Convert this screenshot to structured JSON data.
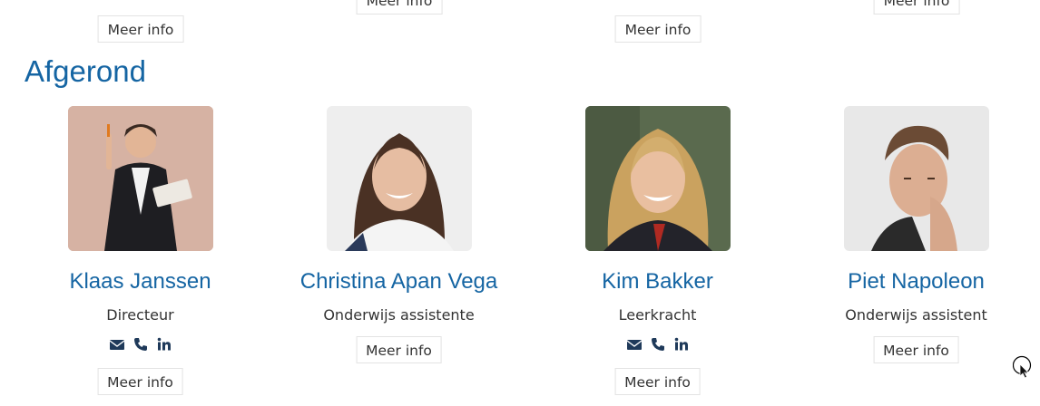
{
  "top_row": {
    "buttons": [
      "Meer info",
      "Meer info",
      "Meer info",
      "Meer info"
    ]
  },
  "section": {
    "title": "Afgerond"
  },
  "people": [
    {
      "name": "Klaas Janssen",
      "role": "Directeur",
      "button": "Meer info",
      "has_contacts": true
    },
    {
      "name": "Christina Apan Vega",
      "role": "Onderwijs assistente",
      "button": "Meer info",
      "has_contacts": false
    },
    {
      "name": "Kim Bakker",
      "role": "Leerkracht",
      "button": "Meer info",
      "has_contacts": true
    },
    {
      "name": "Piet Napoleon",
      "role": "Onderwijs assistent",
      "button": "Meer info",
      "has_contacts": false
    }
  ],
  "icons": [
    "envelope-icon",
    "phone-icon",
    "linkedin-icon"
  ],
  "colors": {
    "accent": "#1565a3",
    "icon": "#1f3a5a"
  }
}
